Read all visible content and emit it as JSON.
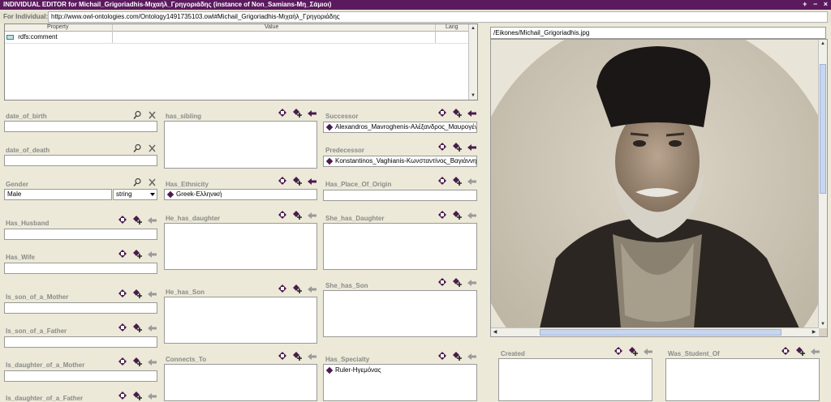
{
  "window": {
    "title": "INDIVIDUAL EDITOR for Michail_Grigoriadhis-Μιχαήλ_Γρηγοριάδης   (instance of Non_Samians-Μη_Σάμιοι)",
    "controls": [
      "+",
      "−",
      "×"
    ]
  },
  "for_individual": {
    "label": "For Individual:",
    "uri": "http://www.owl-ontologies.com/Ontology1491735103.owl#Michail_Grigoriadhis-Μιχαήλ_Γρηγοριάδης"
  },
  "property_table": {
    "headers": [
      "Property",
      "Value",
      "Lang"
    ],
    "rows": [
      {
        "property": "rdfs:comment",
        "value": "",
        "lang": ""
      }
    ]
  },
  "fields": {
    "date_of_birth": {
      "label": "date_of_birth",
      "value": ""
    },
    "date_of_death": {
      "label": "date_of_death",
      "value": ""
    },
    "gender": {
      "label": "Gender",
      "value": "Male",
      "type": "string"
    },
    "has_husband": {
      "label": "Has_Husband",
      "value": ""
    },
    "has_wife": {
      "label": "Has_Wife",
      "value": ""
    },
    "is_son_of_a_mother": {
      "label": "Is_son_of_a_Mother",
      "value": ""
    },
    "is_son_of_a_father": {
      "label": "Is_son_of_a_Father",
      "value": ""
    },
    "is_daughter_of_a_mother": {
      "label": "Is_daughter_of_a_Mother",
      "value": ""
    },
    "is_daughter_of_a_father": {
      "label": "Is_daughter_of_a_Father"
    },
    "has_sibling": {
      "label": "has_sibling",
      "items": []
    },
    "has_ethnicity": {
      "label": "Has_Ethnicity",
      "value": "Greek-Ελληνική"
    },
    "he_has_daughter": {
      "label": "He_has_daughter",
      "items": []
    },
    "he_has_son": {
      "label": "He_has_Son",
      "items": []
    },
    "connects_to": {
      "label": "Connects_To",
      "items": []
    },
    "successor": {
      "label": "Successor",
      "value": "Alexandros_Mavroghenis-Αλέξανδρος_Μαυρογέν..."
    },
    "predecessor": {
      "label": "Predecessor",
      "value": "Konstantinos_Vaghianis-Κωνσταντίνος_Βαγιάννης"
    },
    "has_place_of_origin": {
      "label": "Has_Place_Of_Origin",
      "value": ""
    },
    "she_has_daughter": {
      "label": "She_has_Daughter",
      "items": []
    },
    "she_has_son": {
      "label": "She_has_Son",
      "items": []
    },
    "has_specialty": {
      "label": "Has_Specialty",
      "value": "Ruler-Ηγεμόνας"
    },
    "created": {
      "label": "Created",
      "items": []
    },
    "was_student_of": {
      "label": "Was_Student_Of",
      "items": []
    }
  },
  "image": {
    "path": "/Eikones/Michail_Grigoriadhis.jpg"
  },
  "colors": {
    "titlebar": "#5b1a5e",
    "panel": "#ece9d8",
    "instance": "#4b1b4e",
    "label": "#8a8a8a"
  }
}
